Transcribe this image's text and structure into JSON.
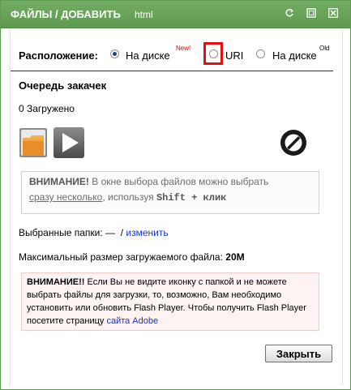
{
  "window": {
    "title": "ФАЙЛЫ / ДОБАВИТЬ",
    "subtitle": "html"
  },
  "location": {
    "label": "Расположение:",
    "options": [
      {
        "label": "На диске",
        "badge": "New!",
        "selected": true
      },
      {
        "label": "URI",
        "badge": "",
        "selected": false
      },
      {
        "label": "На диске",
        "badge": "Old",
        "selected": false
      }
    ]
  },
  "queue": {
    "heading": "Очередь закачек",
    "status": "0 Загружено"
  },
  "note": {
    "bold": "ВНИМАНИЕ!",
    "text1": " В окне выбора файлов можно выбрать",
    "link": "сразу несколько",
    "text2": ", используя ",
    "shortcut": "Shift + клик"
  },
  "folders": {
    "label": "Выбранные папки:",
    "value": "—",
    "separator": "/",
    "change_link": "изменить"
  },
  "max_size": {
    "label": "Максимальный размер загружаемого файла:",
    "value": "20M"
  },
  "warning": {
    "bold": "ВНИМАНИЕ!!",
    "text": " Если Вы не видите иконку с папкой и не можете выбрать файлы для загрузки, то, возможно, Вам необходимо установить или обновить Flash Player. Чтобы получить Flash Player посетите страницу ",
    "link": "сайта Adobe"
  },
  "buttons": {
    "close": "Закрыть"
  },
  "colors": {
    "titlebar": "#6aa55b",
    "accent_red": "#e01010",
    "link": "#1a33c8"
  }
}
